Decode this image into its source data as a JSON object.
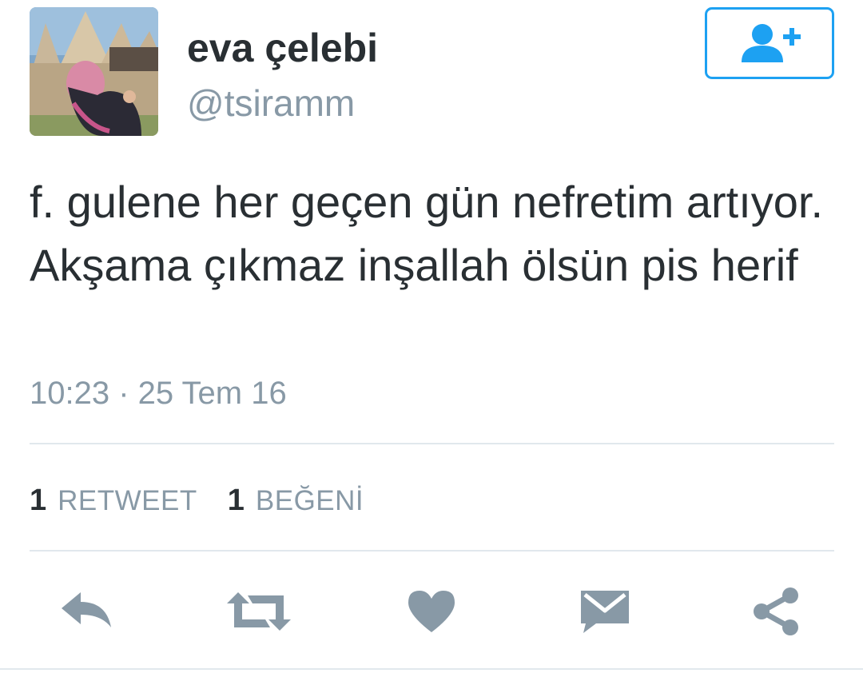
{
  "user": {
    "display_name": "eva çelebi",
    "handle": "@tsiramm"
  },
  "follow_button": {
    "icon": "add-user-icon"
  },
  "tweet": {
    "text": "f. gulene her geçen gün nefretim artıyor. Akşama çıkmaz inşallah ölsün pis herif",
    "timestamp": "10:23 · 25 Tem 16"
  },
  "stats": {
    "retweet_count": "1",
    "retweet_label": "RETWEET",
    "like_count": "1",
    "like_label": "BEĞENİ"
  },
  "actions": [
    {
      "icon": "reply-icon"
    },
    {
      "icon": "retweet-icon"
    },
    {
      "icon": "heart-icon"
    },
    {
      "icon": "message-icon"
    },
    {
      "icon": "share-icon"
    }
  ],
  "colors": {
    "accent": "#1da1f2",
    "text": "#292f33",
    "muted": "#8899a6",
    "icon": "#8899a6",
    "divider": "#e1e8ed"
  }
}
